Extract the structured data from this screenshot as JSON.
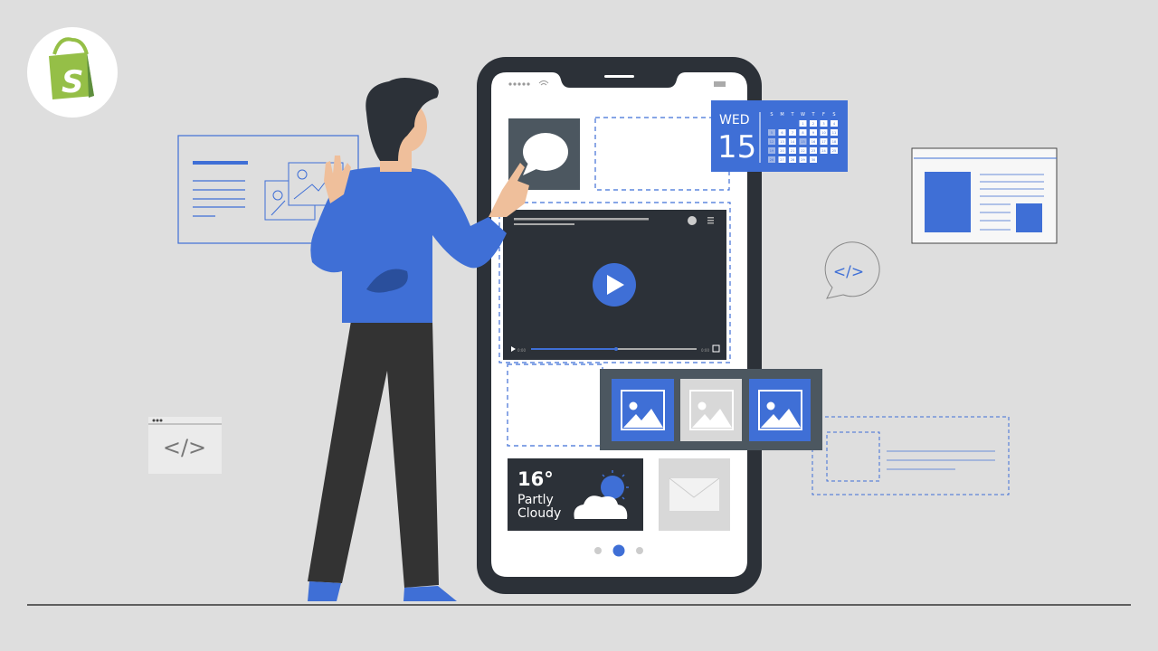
{
  "brand": {
    "logo": "shopify-bag-logo",
    "logo_letter": "S",
    "logo_color": "#95bf47"
  },
  "colors": {
    "background": "#dedede",
    "accent": "#3f6fd6",
    "phone_body": "#2c3138",
    "tile_dark": "#4c5760",
    "tile_light": "#d8d8d8"
  },
  "calendar": {
    "day_name": "WED",
    "day_number": "15",
    "weekday_headers": [
      "S",
      "M",
      "T",
      "W",
      "T",
      "F",
      "S"
    ],
    "weeks": [
      [
        "",
        "",
        "",
        "1",
        "2",
        "3",
        "4"
      ],
      [
        "5",
        "6",
        "7",
        "8",
        "9",
        "10",
        "11"
      ],
      [
        "12",
        "13",
        "14",
        "15",
        "16",
        "17",
        "18"
      ],
      [
        "19",
        "20",
        "21",
        "22",
        "23",
        "24",
        "25"
      ],
      [
        "26",
        "27",
        "28",
        "29",
        "30",
        "",
        ""
      ]
    ],
    "highlighted_day": "15"
  },
  "video": {
    "time_current": "0:00",
    "time_total": "0:00",
    "progress": 0.45,
    "icons": [
      "play-icon",
      "fullscreen-icon",
      "avatar-icon",
      "menu-icon"
    ]
  },
  "weather": {
    "temperature": "16°",
    "condition_line1": "Partly",
    "condition_line2": "Cloudy",
    "icon": "partly-cloudy-icon"
  },
  "pagination": {
    "pages": 3,
    "active_page": 2
  },
  "gallery": {
    "items": [
      {
        "icon": "image-icon",
        "style": "blue"
      },
      {
        "icon": "image-icon",
        "style": "gray"
      },
      {
        "icon": "image-icon",
        "style": "blue"
      }
    ]
  },
  "code_snippets": {
    "left_window": "</>",
    "bubble": "</>"
  }
}
